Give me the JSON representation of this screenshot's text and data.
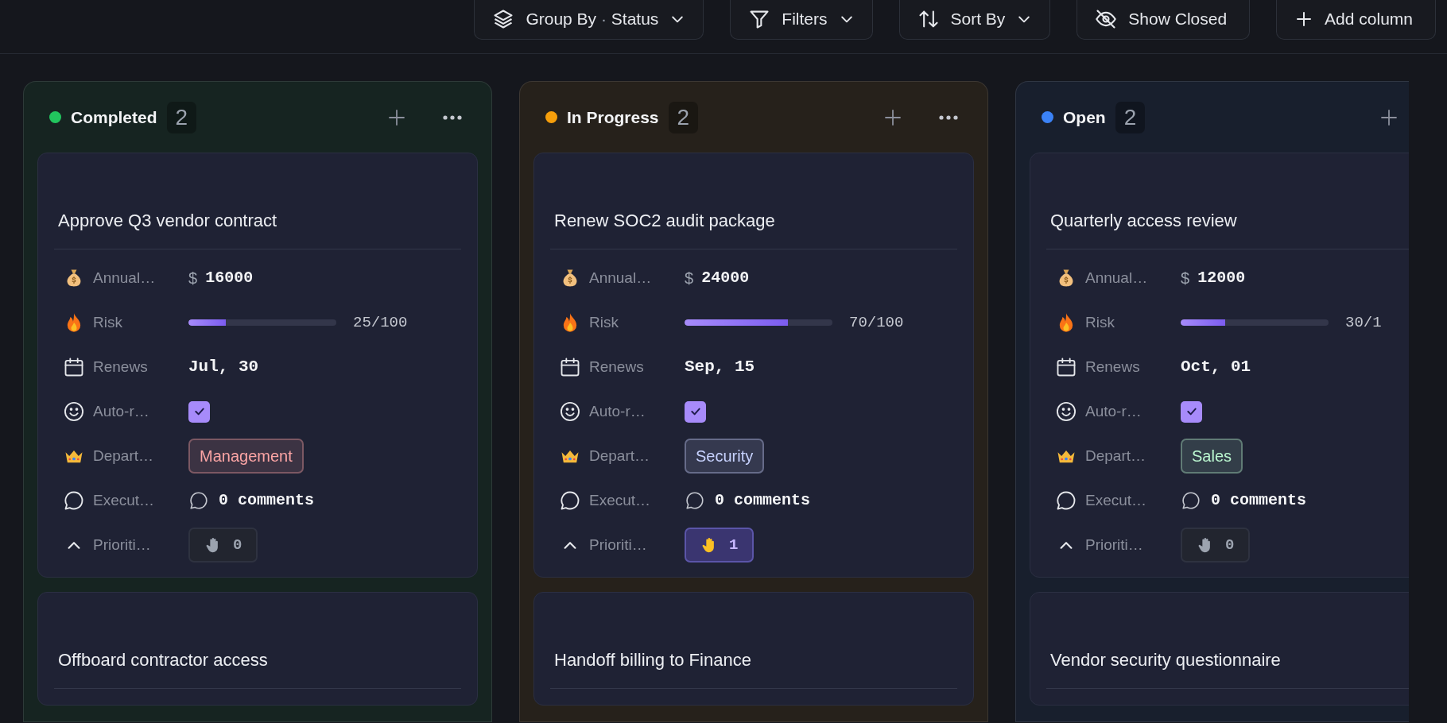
{
  "toolbar": [
    {
      "kind": "group",
      "label": "Group By",
      "separator": "·",
      "value": "Status"
    },
    {
      "kind": "filter",
      "label": "Filters"
    },
    {
      "kind": "sort",
      "label": "Sort By"
    },
    {
      "kind": "hidden",
      "label": "Show Closed"
    },
    {
      "kind": "add",
      "label": "Add column"
    }
  ],
  "columns": [
    {
      "title": "Completed",
      "color": "#22c55e",
      "count": "2",
      "cards": [
        {
          "title": "Approve Q3 vendor contract",
          "fields": [
            {
              "kind": "money",
              "label": "Annual…",
              "currency": "$",
              "value": "16000"
            },
            {
              "kind": "progress",
              "label": "Risk",
              "level": 0.25,
              "reading": "25/100"
            },
            {
              "kind": "date",
              "label": "Renews",
              "value": "Jul, 30"
            },
            {
              "kind": "checkbox",
              "label": "Auto-r…",
              "checked": true
            },
            {
              "kind": "tag",
              "label": "Depart…",
              "value": "Management",
              "color": "#fca5a5"
            },
            {
              "kind": "comments",
              "label": "Execut…",
              "value": "0 comments"
            },
            {
              "kind": "vote",
              "label": "Prioriti…",
              "value": "0",
              "selected": false
            }
          ]
        },
        {
          "title": "Offboard contractor access"
        }
      ]
    },
    {
      "title": "In Progress",
      "color": "#f59e0b",
      "count": "2",
      "cards": [
        {
          "title": "Renew SOC2 audit package",
          "fields": [
            {
              "kind": "money",
              "label": "Annual…",
              "currency": "$",
              "value": "24000"
            },
            {
              "kind": "progress",
              "label": "Risk",
              "level": 0.7,
              "reading": "70/100"
            },
            {
              "kind": "date",
              "label": "Renews",
              "value": "Sep, 15"
            },
            {
              "kind": "checkbox",
              "label": "Auto-r…",
              "checked": true
            },
            {
              "kind": "tag",
              "label": "Depart…",
              "value": "Security",
              "color": "#c7d2fe"
            },
            {
              "kind": "comments",
              "label": "Execut…",
              "value": "0 comments"
            },
            {
              "kind": "vote",
              "label": "Prioriti…",
              "value": "1",
              "selected": true
            }
          ]
        },
        {
          "title": "Handoff billing to Finance"
        }
      ]
    },
    {
      "title": "Open",
      "color": "#3b82f6",
      "count": "2",
      "cards": [
        {
          "title": "Quarterly access review",
          "fields": [
            {
              "kind": "money",
              "label": "Annual…",
              "currency": "$",
              "value": "12000"
            },
            {
              "kind": "progress",
              "label": "Risk",
              "level": 0.3,
              "reading": "30/1"
            },
            {
              "kind": "date",
              "label": "Renews",
              "value": "Oct, 01"
            },
            {
              "kind": "checkbox",
              "label": "Auto-r…",
              "checked": true
            },
            {
              "kind": "tag",
              "label": "Depart…",
              "value": "Sales",
              "color": "#bbf7d0"
            },
            {
              "kind": "comments",
              "label": "Execut…",
              "value": "0 comments"
            },
            {
              "kind": "vote",
              "label": "Prioriti…",
              "value": "0",
              "selected": false
            }
          ]
        },
        {
          "title": "Vendor security questionnaire"
        }
      ]
    }
  ]
}
